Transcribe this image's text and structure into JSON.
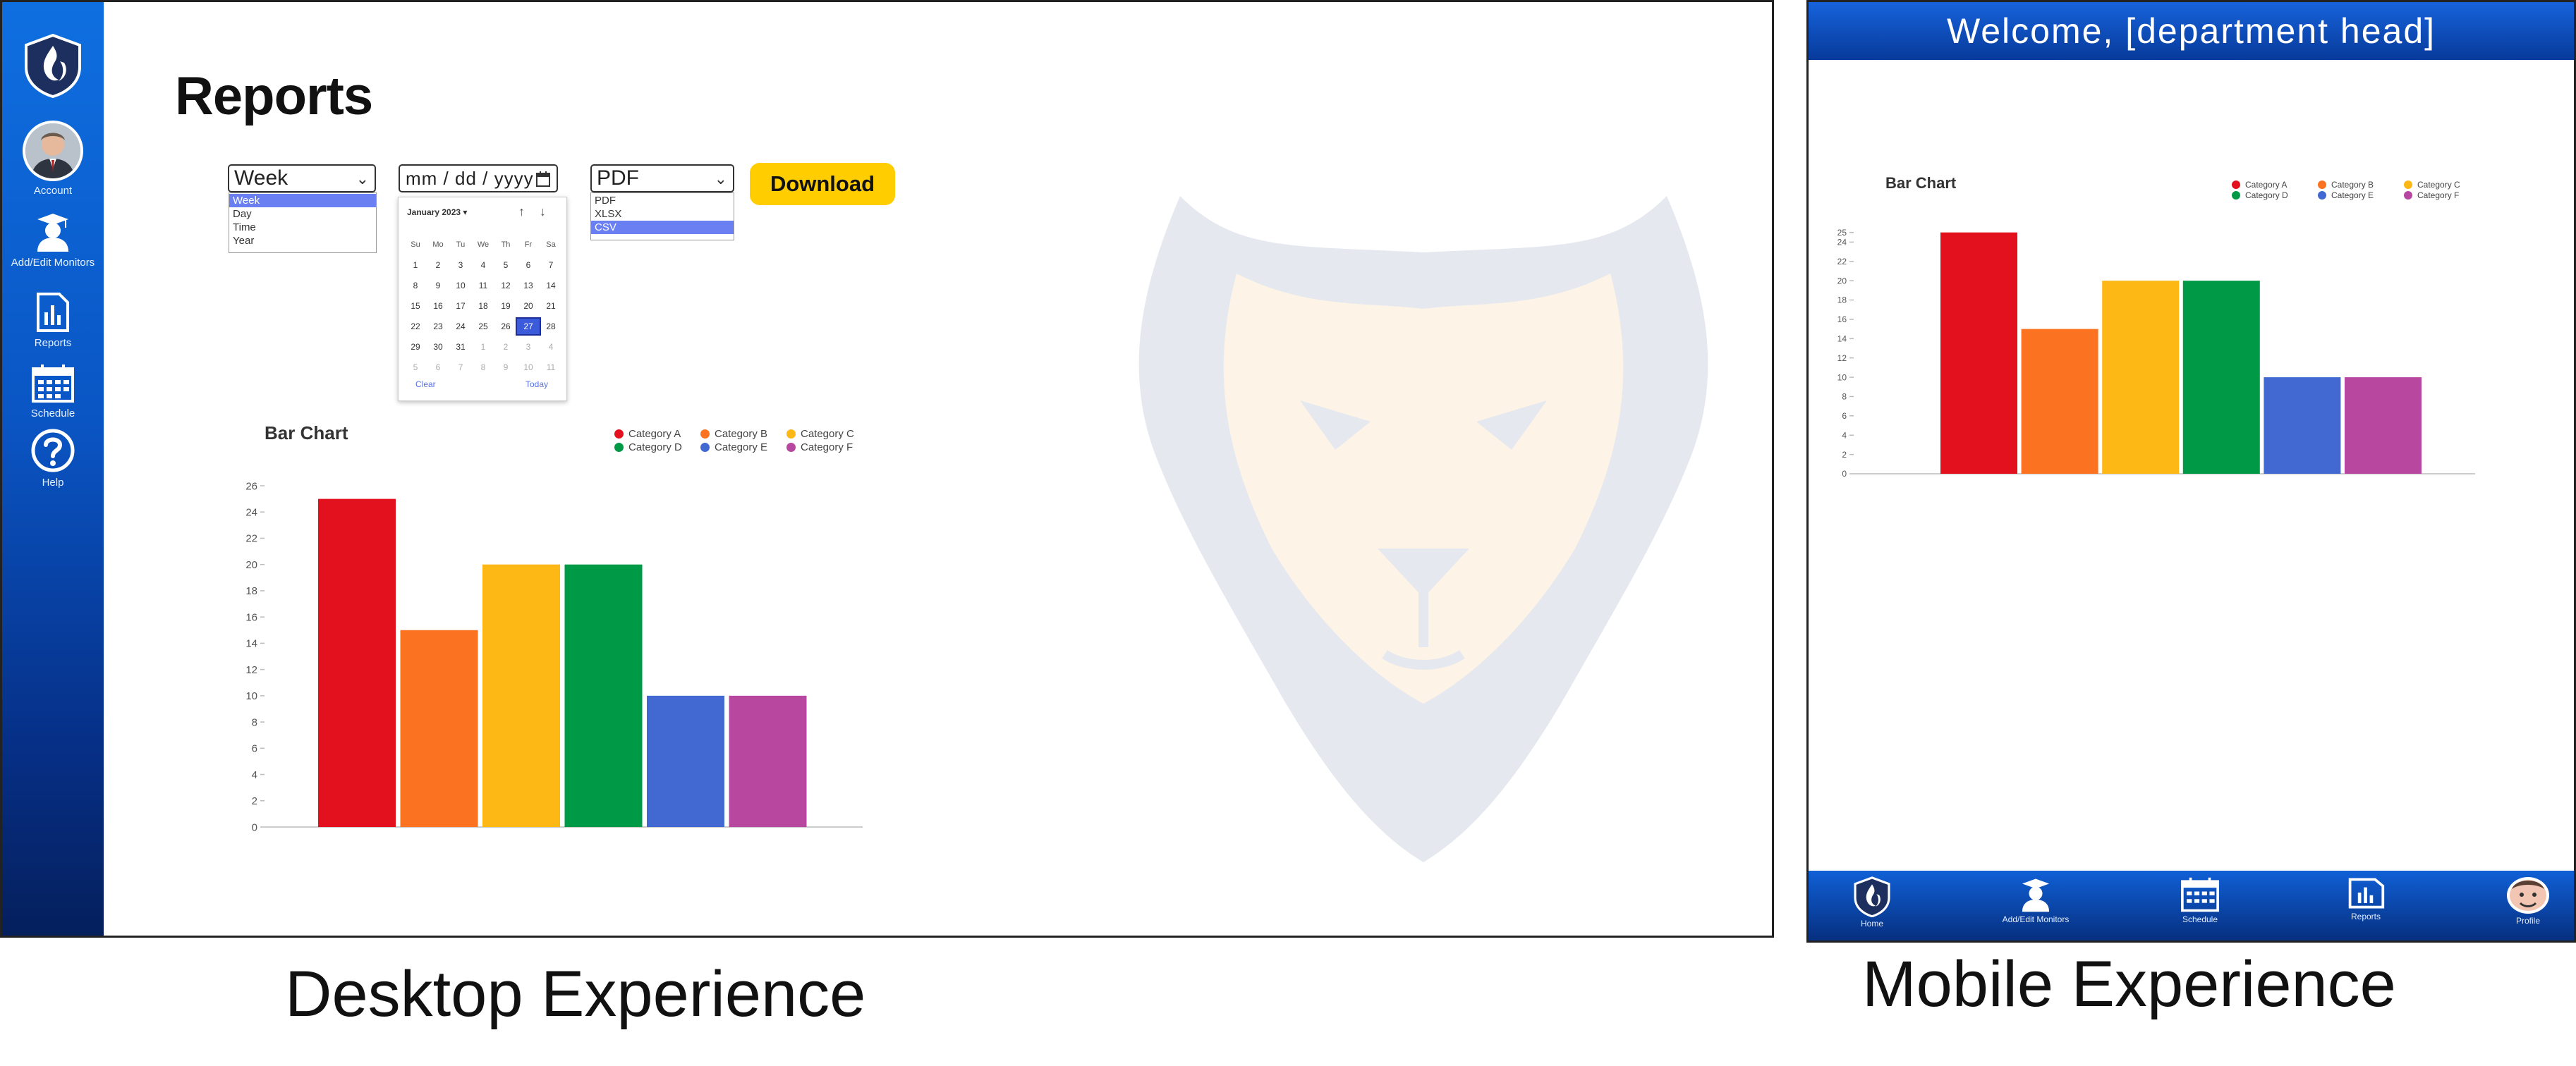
{
  "colors": {
    "brand_blue": "#0a55c4",
    "brand_dark": "#051f5c",
    "accent_yellow": "#ffcd00",
    "selection": "#6a80f2"
  },
  "desktop": {
    "sidebar": {
      "items": [
        {
          "label": "",
          "icon": "university-flame-logo-icon"
        },
        {
          "label": "Account",
          "icon": "avatar"
        },
        {
          "label": "Add/Edit Monitors",
          "icon": "graduate-user-icon"
        },
        {
          "label": "Reports",
          "icon": "bar-report-icon"
        },
        {
          "label": "Schedule",
          "icon": "calendar-icon"
        },
        {
          "label": "Help",
          "icon": "help-circle-icon"
        }
      ]
    },
    "page_title": "Reports",
    "period_select": {
      "value": "Week",
      "options": [
        "Week",
        "Day",
        "Time",
        "Year"
      ],
      "highlighted": "Week"
    },
    "date_input": {
      "placeholder": "mm / dd / yyyy"
    },
    "calendar": {
      "month": "January 2023 ▾",
      "weekdays": [
        "Su",
        "Mo",
        "Tu",
        "We",
        "Th",
        "Fr",
        "Sa"
      ],
      "weeks": [
        [
          "1",
          "2",
          "3",
          "4",
          "5",
          "6",
          "7"
        ],
        [
          "8",
          "9",
          "10",
          "11",
          "12",
          "13",
          "14"
        ],
        [
          "15",
          "16",
          "17",
          "18",
          "19",
          "20",
          "21"
        ],
        [
          "22",
          "23",
          "24",
          "25",
          "26",
          "27",
          "28"
        ],
        [
          "29",
          "30",
          "31",
          "1",
          "2",
          "3",
          "4"
        ],
        [
          "5",
          "6",
          "7",
          "8",
          "9",
          "10",
          "11"
        ]
      ],
      "selected": "27",
      "clear_label": "Clear",
      "today_label": "Today"
    },
    "format_select": {
      "value": "PDF",
      "options": [
        "PDF",
        "XLSX",
        "CSV"
      ],
      "highlighted": "CSV"
    },
    "download_label": "Download",
    "caption": "Desktop Experience"
  },
  "mobile": {
    "header": "Welcome, [department head]",
    "nav": [
      {
        "label": "Home",
        "icon": "university-flame-logo-icon"
      },
      {
        "label": "Add/Edit Monitors",
        "icon": "graduate-user-icon"
      },
      {
        "label": "Schedule",
        "icon": "calendar-icon"
      },
      {
        "label": "Reports",
        "icon": "bar-report-icon"
      },
      {
        "label": "Profile",
        "icon": "avatar"
      }
    ],
    "caption": "Mobile Experience"
  },
  "chart_data": [
    {
      "type": "bar",
      "title": "Bar Chart",
      "categories": [
        "Category A",
        "Category B",
        "Category C",
        "Category D",
        "Category E",
        "Category F"
      ],
      "values": [
        25,
        15,
        20,
        20,
        10,
        10
      ],
      "colors": [
        "#e3111e",
        "#fb7321",
        "#fdb815",
        "#009945",
        "#4169d1",
        "#b7479f"
      ],
      "ylim": [
        0,
        26
      ],
      "yticks": [
        0,
        2,
        4,
        6,
        8,
        10,
        12,
        14,
        16,
        18,
        20,
        22,
        24,
        26
      ],
      "legend": "top-right"
    },
    {
      "type": "bar",
      "title": "Bar Chart",
      "categories": [
        "Category A",
        "Category B",
        "Category C",
        "Category D",
        "Category E",
        "Category F"
      ],
      "values": [
        25,
        15,
        20,
        20,
        10,
        10
      ],
      "colors": [
        "#e3111e",
        "#fb7321",
        "#fdb815",
        "#009945",
        "#4169d1",
        "#b7479f"
      ],
      "ylim": [
        0,
        26
      ],
      "yticks": [
        0,
        2,
        4,
        6,
        8,
        10,
        12,
        14,
        16,
        18,
        20,
        22,
        24,
        25
      ],
      "legend": "top-right"
    }
  ]
}
